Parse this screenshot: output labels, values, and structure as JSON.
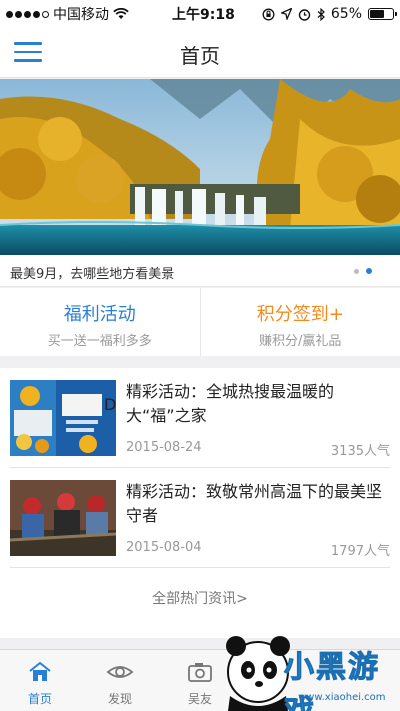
{
  "status_bar": {
    "carrier": "中国移动",
    "time": "上午9:18",
    "battery_percent": "65%",
    "battery_level": 0.65,
    "icons": [
      "signal-dots",
      "wifi-icon",
      "rotation-lock-icon",
      "location-icon",
      "alarm-icon",
      "bluetooth-icon",
      "battery-icon"
    ]
  },
  "nav": {
    "title": "首页",
    "menu_icon": "hamburger-menu-icon"
  },
  "banner": {
    "caption": "最美9月，去哪些地方看美景",
    "slide_count": 2,
    "active_slide": 2
  },
  "quick_actions": [
    {
      "title": "福利活动",
      "subtitle": "买一送一福利多多",
      "color": "#2a7fd4"
    },
    {
      "title": "积分签到+",
      "subtitle": "赚积分/赢礼品",
      "color": "#f08b1d"
    }
  ],
  "news": [
    {
      "title": "精彩活动：全城热搜最温暖的大“福”之家",
      "date": "2015-08-24",
      "popularity": "3135人气"
    },
    {
      "title": "精彩活动：致敬常州高温下的最美坚守者",
      "date": "2015-08-04",
      "popularity": "1797人气"
    }
  ],
  "more_link": "全部热门资讯>",
  "tabs": [
    {
      "label": "首页",
      "icon": "home-icon",
      "active": true
    },
    {
      "label": "发现",
      "icon": "eye-icon",
      "active": false
    },
    {
      "label": "吴友",
      "icon": "camera-icon",
      "active": false
    }
  ],
  "watermark": {
    "text": "小黑游戏",
    "url": "www.xiaohei.com"
  },
  "colors": {
    "accent": "#2a7fd4",
    "orange": "#f08b1d"
  }
}
